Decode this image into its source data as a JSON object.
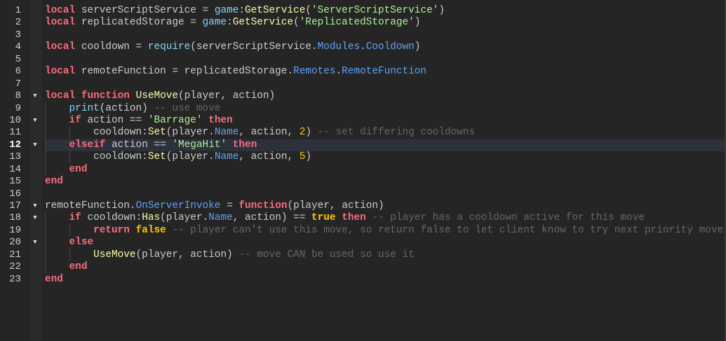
{
  "editor": {
    "current_line": 12,
    "colors": {
      "keyword": "#f86d7c",
      "builtin": "#84d6f7",
      "method": "#fdfbac",
      "property": "#61a1f1",
      "string": "#adf195",
      "number": "#ffc600",
      "comment": "#666666",
      "text": "#cccccc",
      "background": "#252525",
      "current_line": "#2c313c"
    },
    "fold_icon": "triangle-down-icon",
    "lines": [
      {
        "n": "1",
        "fold": false,
        "indent": 0,
        "tokens": [
          [
            "kw",
            "local"
          ],
          [
            "tx",
            " serverScriptService = "
          ],
          [
            "bi",
            "game"
          ],
          [
            "tx",
            ":"
          ],
          [
            "fn",
            "GetService"
          ],
          [
            "tx",
            "("
          ],
          [
            "st",
            "'ServerScriptService'"
          ],
          [
            "tx",
            ")"
          ]
        ]
      },
      {
        "n": "2",
        "fold": false,
        "indent": 0,
        "tokens": [
          [
            "kw",
            "local"
          ],
          [
            "tx",
            " replicatedStorage = "
          ],
          [
            "bi",
            "game"
          ],
          [
            "tx",
            ":"
          ],
          [
            "fn",
            "GetService"
          ],
          [
            "tx",
            "("
          ],
          [
            "st",
            "'ReplicatedStorage'"
          ],
          [
            "tx",
            ")"
          ]
        ]
      },
      {
        "n": "3",
        "fold": false,
        "indent": 0,
        "tokens": []
      },
      {
        "n": "4",
        "fold": false,
        "indent": 0,
        "tokens": [
          [
            "kw",
            "local"
          ],
          [
            "tx",
            " cooldown = "
          ],
          [
            "bi",
            "require"
          ],
          [
            "tx",
            "(serverScriptService."
          ],
          [
            "pr",
            "Modules"
          ],
          [
            "tx",
            "."
          ],
          [
            "pr",
            "Cooldown"
          ],
          [
            "tx",
            ")"
          ]
        ]
      },
      {
        "n": "5",
        "fold": false,
        "indent": 0,
        "tokens": []
      },
      {
        "n": "6",
        "fold": false,
        "indent": 0,
        "tokens": [
          [
            "kw",
            "local"
          ],
          [
            "tx",
            " remoteFunction = replicatedStorage."
          ],
          [
            "pr",
            "Remotes"
          ],
          [
            "tx",
            "."
          ],
          [
            "pr",
            "RemoteFunction"
          ]
        ]
      },
      {
        "n": "7",
        "fold": false,
        "indent": 0,
        "tokens": []
      },
      {
        "n": "8",
        "fold": true,
        "indent": 0,
        "tokens": [
          [
            "kw",
            "local"
          ],
          [
            "tx",
            " "
          ],
          [
            "kw",
            "function"
          ],
          [
            "tx",
            " "
          ],
          [
            "fn",
            "UseMove"
          ],
          [
            "tx",
            "(player, action)"
          ]
        ]
      },
      {
        "n": "9",
        "fold": false,
        "indent": 1,
        "tokens": [
          [
            "tx",
            "    "
          ],
          [
            "bi",
            "print"
          ],
          [
            "tx",
            "(action) "
          ],
          [
            "cm",
            "-- use move"
          ]
        ]
      },
      {
        "n": "10",
        "fold": true,
        "indent": 1,
        "tokens": [
          [
            "tx",
            "    "
          ],
          [
            "kw",
            "if"
          ],
          [
            "tx",
            " action == "
          ],
          [
            "st",
            "'Barrage'"
          ],
          [
            "tx",
            " "
          ],
          [
            "kw",
            "then"
          ]
        ]
      },
      {
        "n": "11",
        "fold": false,
        "indent": 2,
        "tokens": [
          [
            "tx",
            "        cooldown:"
          ],
          [
            "fn",
            "Set"
          ],
          [
            "tx",
            "(player."
          ],
          [
            "pr",
            "Name"
          ],
          [
            "tx",
            ", action, "
          ],
          [
            "nu",
            "2"
          ],
          [
            "tx",
            ") "
          ],
          [
            "cm",
            "-- set differing cooldowns"
          ]
        ]
      },
      {
        "n": "12",
        "fold": true,
        "indent": 1,
        "tokens": [
          [
            "tx",
            "    "
          ],
          [
            "kw",
            "elseif"
          ],
          [
            "tx",
            " action == "
          ],
          [
            "st",
            "'MegaHit'"
          ],
          [
            "tx",
            " "
          ],
          [
            "kw",
            "then"
          ]
        ]
      },
      {
        "n": "13",
        "fold": false,
        "indent": 2,
        "tokens": [
          [
            "tx",
            "        cooldown:"
          ],
          [
            "fn",
            "Set"
          ],
          [
            "tx",
            "(player."
          ],
          [
            "pr",
            "Name"
          ],
          [
            "tx",
            ", action, "
          ],
          [
            "nu",
            "5"
          ],
          [
            "tx",
            ")"
          ]
        ]
      },
      {
        "n": "14",
        "fold": false,
        "indent": 1,
        "tokens": [
          [
            "tx",
            "    "
          ],
          [
            "kw",
            "end"
          ]
        ]
      },
      {
        "n": "15",
        "fold": false,
        "indent": 0,
        "tokens": [
          [
            "kw",
            "end"
          ]
        ]
      },
      {
        "n": "16",
        "fold": false,
        "indent": 0,
        "tokens": []
      },
      {
        "n": "17",
        "fold": true,
        "indent": 0,
        "tokens": [
          [
            "tx",
            "remoteFunction."
          ],
          [
            "pr",
            "OnServerInvoke"
          ],
          [
            "tx",
            " = "
          ],
          [
            "kw",
            "function"
          ],
          [
            "tx",
            "(player, action)"
          ]
        ]
      },
      {
        "n": "18",
        "fold": true,
        "indent": 1,
        "tokens": [
          [
            "tx",
            "    "
          ],
          [
            "kw",
            "if"
          ],
          [
            "tx",
            " cooldown:"
          ],
          [
            "fn",
            "Has"
          ],
          [
            "tx",
            "(player."
          ],
          [
            "pr",
            "Name"
          ],
          [
            "tx",
            ", action) == "
          ],
          [
            "bo",
            "true"
          ],
          [
            "tx",
            " "
          ],
          [
            "kw",
            "then"
          ],
          [
            "tx",
            " "
          ],
          [
            "cm",
            "-- player has a cooldown active for this move"
          ]
        ]
      },
      {
        "n": "19",
        "fold": false,
        "indent": 2,
        "tokens": [
          [
            "tx",
            "        "
          ],
          [
            "kw",
            "return"
          ],
          [
            "tx",
            " "
          ],
          [
            "bo",
            "false"
          ],
          [
            "tx",
            " "
          ],
          [
            "cm",
            "-- player can't use this move, so return false to let client know to try next priority move"
          ]
        ]
      },
      {
        "n": "20",
        "fold": true,
        "indent": 1,
        "tokens": [
          [
            "tx",
            "    "
          ],
          [
            "kw",
            "else"
          ]
        ]
      },
      {
        "n": "21",
        "fold": false,
        "indent": 2,
        "tokens": [
          [
            "tx",
            "        "
          ],
          [
            "fn",
            "UseMove"
          ],
          [
            "tx",
            "(player, action) "
          ],
          [
            "cm",
            "-- move CAN be used so use it"
          ]
        ]
      },
      {
        "n": "22",
        "fold": false,
        "indent": 1,
        "tokens": [
          [
            "tx",
            "    "
          ],
          [
            "kw",
            "end"
          ]
        ]
      },
      {
        "n": "23",
        "fold": false,
        "indent": 0,
        "tokens": [
          [
            "kw",
            "end"
          ]
        ]
      }
    ]
  }
}
